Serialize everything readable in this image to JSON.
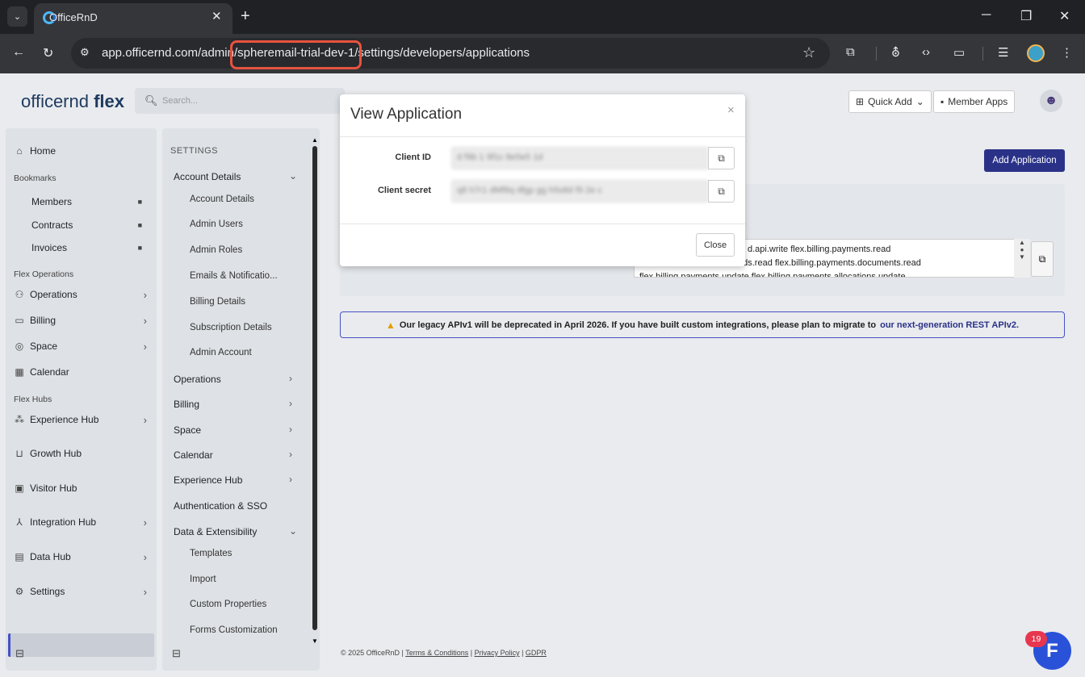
{
  "browser": {
    "tab_title": "OfficeRnD",
    "url_prefix": "app.officernd.com/admin/",
    "url_highlight": "spheremail-trial-dev-1/",
    "url_suffix": "settings/developers/applications"
  },
  "header": {
    "logo_light": "officernd",
    "logo_bold": " flex",
    "search_placeholder": "Search...",
    "quick_add": "Quick Add",
    "member_apps": "Member Apps"
  },
  "sidebar": {
    "home": "Home",
    "bookmarks_title": "Bookmarks",
    "bookmarks": [
      "Members",
      "Contracts",
      "Invoices"
    ],
    "flex_operations_title": "Flex Operations",
    "operations": "Operations",
    "billing": "Billing",
    "space": "Space",
    "calendar": "Calendar",
    "flex_hubs_title": "Flex Hubs",
    "experience_hub": "Experience Hub",
    "growth_hub": "Growth Hub",
    "visitor_hub": "Visitor Hub",
    "integration_hub": "Integration Hub",
    "data_hub": "Data Hub",
    "settings": "Settings"
  },
  "settings_nav": {
    "heading": "SETTINGS",
    "account_details_group": "Account Details",
    "account_sub": [
      "Account Details",
      "Admin Users",
      "Admin Roles",
      "Emails & Notificatio...",
      "Billing Details",
      "Subscription Details",
      "Admin Account"
    ],
    "groups": [
      "Operations",
      "Billing",
      "Space",
      "Calendar",
      "Experience Hub"
    ],
    "auth": "Authentication & SSO",
    "data_ext_group": "Data & Extensibility",
    "data_sub": [
      "Templates",
      "Import",
      "Custom Properties",
      "Forms Customization"
    ]
  },
  "main": {
    "add_application": "Add Application",
    "scopes_line1": "d.api.write flex.billing.payments.read",
    "scopes_line2": "ods.read flex.billing.payments.documents.read",
    "scopes_line3": "flex.billing.payments.update flex.billing.payments.allocations.update",
    "banner_text": "Our legacy APIv1 will be deprecated in April 2026. If you have built custom integrations, please plan to migrate to",
    "banner_link": "our next-generation REST APIv2."
  },
  "footer": {
    "copyright": "© 2025 OfficeRnD |",
    "terms": "Terms & Conditions",
    "privacy": "Privacy Policy",
    "gdpr": "GDPR"
  },
  "modal": {
    "title": "View Application",
    "client_id_label": "Client ID",
    "client_id_value": "d f9b 1 9f1c 8e5e5 1d",
    "client_secret_label": "Client secret",
    "client_secret_value": "q8 h7r1 dMf8q dfgp gg h5s8d f9 2e c",
    "close_label": "Close"
  },
  "chat": {
    "badge": "19"
  }
}
